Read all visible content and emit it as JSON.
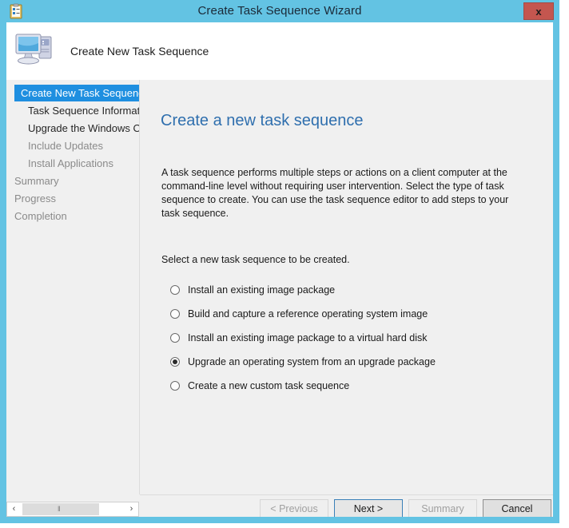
{
  "window": {
    "title": "Create Task Sequence Wizard",
    "title_icon": "clipboard-checklist-icon",
    "close_label": "x",
    "titlebar_color": "#63c3e3",
    "close_button_color": "#c4564f"
  },
  "banner": {
    "icon": "computer-icon",
    "heading": "Create New Task Sequence"
  },
  "sidebar": {
    "items": [
      {
        "label": "Create New Task Sequence",
        "level": 0,
        "state": "selected"
      },
      {
        "label": "Task Sequence Informatio",
        "level": 1,
        "state": "enabled"
      },
      {
        "label": "Upgrade the Windows Op",
        "level": 1,
        "state": "enabled"
      },
      {
        "label": "Include Updates",
        "level": 1,
        "state": "disabled"
      },
      {
        "label": "Install Applications",
        "level": 1,
        "state": "disabled"
      },
      {
        "label": "Summary",
        "level": 0,
        "state": "disabled"
      },
      {
        "label": "Progress",
        "level": 0,
        "state": "disabled"
      },
      {
        "label": "Completion",
        "level": 0,
        "state": "disabled"
      }
    ],
    "selected_color": "#1f8fe0"
  },
  "scrollbar": {
    "left_arrow": "‹",
    "right_arrow": "›",
    "grip": "‖"
  },
  "content": {
    "title": "Create a new task sequence",
    "title_color": "#2f6fae",
    "description": "A task sequence performs multiple steps or actions on a client computer at the command-line level without requiring user intervention. Select the type of task sequence to create. You can use the task sequence editor to add steps to your task sequence.",
    "prompt": "Select a new task sequence to be created.",
    "options": [
      {
        "label": "Install an existing image package",
        "selected": false
      },
      {
        "label": "Build and capture a reference operating system image",
        "selected": false
      },
      {
        "label": "Install an existing image package to a virtual hard disk",
        "selected": false
      },
      {
        "label": "Upgrade an operating system from an upgrade package",
        "selected": true
      },
      {
        "label": "Create a new custom task sequence",
        "selected": false
      }
    ]
  },
  "footer": {
    "previous_label": "< Previous",
    "next_label": "Next >",
    "summary_label": "Summary",
    "cancel_label": "Cancel",
    "previous_enabled": false,
    "next_enabled": true,
    "summary_enabled": false,
    "cancel_enabled": true
  }
}
